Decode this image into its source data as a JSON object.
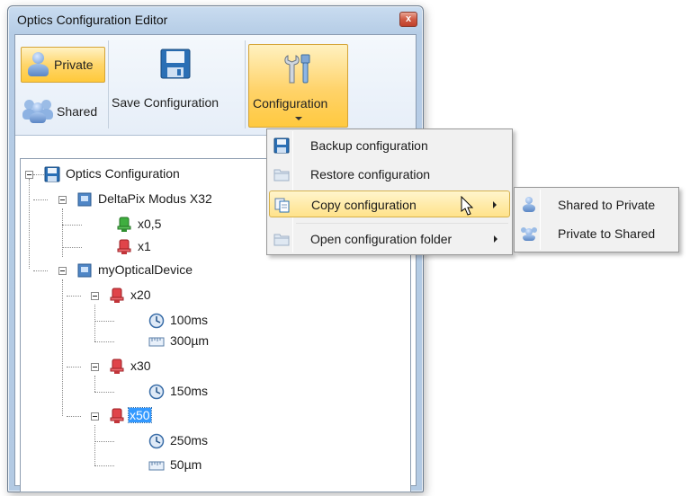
{
  "window": {
    "title": "Optics Configuration Editor",
    "close_glyph": "x"
  },
  "ribbon": {
    "private_label": "Private",
    "shared_label": "Shared",
    "save_label": "Save Configuration",
    "configuration_label": "Configuration"
  },
  "tree": {
    "root": "Optics Configuration",
    "nodes": {
      "device1": "DeltaPix Modus X32",
      "d1_obj1": "x0,5",
      "d1_obj2": "x1",
      "device2": "myOpticalDevice",
      "d2_obj1": "x20",
      "d2_obj1_time": "100ms",
      "d2_obj1_dist": "300µm",
      "d2_obj2": "x30",
      "d2_obj2_time": "150ms",
      "d2_obj3": "x50",
      "d2_obj3_time": "250ms",
      "d2_obj3_dist": "50µm"
    }
  },
  "menu": {
    "items": [
      {
        "label": "Backup configuration",
        "icon": "floppy-icon"
      },
      {
        "label": "Restore configuration",
        "icon": "folder-icon"
      },
      {
        "label": "Copy configuration",
        "icon": "copy-icon"
      },
      {
        "label": "Open configuration folder",
        "icon": "folder-icon"
      }
    ],
    "submenu": [
      {
        "label": "Shared to Private",
        "icon": "user-icon"
      },
      {
        "label": "Private to Shared",
        "icon": "users-icon"
      }
    ]
  },
  "colors": {
    "highlight": "#ffd66b",
    "selection": "#3399ff",
    "objective_green": "#3fae3f",
    "objective_red": "#e0444a"
  }
}
